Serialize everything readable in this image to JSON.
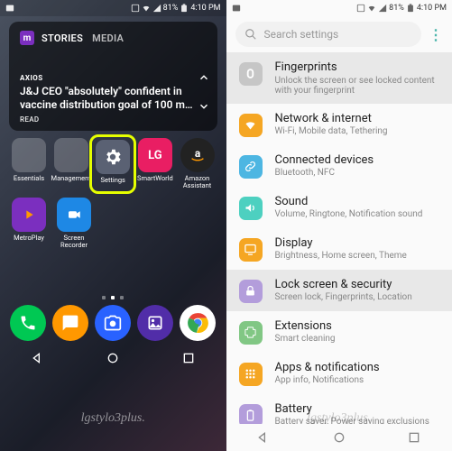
{
  "status": {
    "battery": "81%",
    "time": "4:10 PM"
  },
  "widget": {
    "tabs": [
      "STORIES",
      "MEDIA"
    ],
    "source": "AXIOS",
    "headline": "J&J CEO \"absolutely\" confident in vaccine distribution goal of 100 m…",
    "read": "READ"
  },
  "apps_row1": [
    {
      "label": "Essentials",
      "type": "folder"
    },
    {
      "label": "Management",
      "type": "folder-mgmt"
    },
    {
      "label": "Settings",
      "type": "settings",
      "highlight": true
    },
    {
      "label": "SmartWorld",
      "type": "lg"
    },
    {
      "label": "Amazon Assistant",
      "type": "amazon"
    }
  ],
  "apps_row2": [
    {
      "label": "MetroPlay",
      "type": "metro"
    },
    {
      "label": "Screen Recorder",
      "type": "recorder"
    }
  ],
  "search": {
    "placeholder": "Search settings"
  },
  "settings": [
    {
      "title": "Fingerprints",
      "sub": "Unlock the screen or see locked content with your fingerprint",
      "color": "#c6c6c6",
      "selected": true,
      "icon": "finger"
    },
    {
      "title": "Network & internet",
      "sub": "Wi-Fi, Mobile data, Tethering",
      "color": "#f5a623",
      "icon": "wifi"
    },
    {
      "title": "Connected devices",
      "sub": "Bluetooth, NFC",
      "color": "#4db6e2",
      "icon": "link"
    },
    {
      "title": "Sound",
      "sub": "Volume, Ringtone, Notification sound",
      "color": "#4dd0c0",
      "icon": "sound"
    },
    {
      "title": "Display",
      "sub": "Brightness, Home screen, Theme",
      "color": "#f5a623",
      "icon": "display"
    },
    {
      "title": "Lock screen & security",
      "sub": "Screen lock, Fingerprints, Location",
      "color": "#b39ddb",
      "selected": true,
      "icon": "lock"
    },
    {
      "title": "Extensions",
      "sub": "Smart cleaning",
      "color": "#81c784",
      "icon": "ext"
    },
    {
      "title": "Apps & notifications",
      "sub": "App info, Notifications",
      "color": "#f5a623",
      "icon": "apps"
    },
    {
      "title": "Battery",
      "sub": "Battery saver, Power saving exclusions",
      "color": "#b39ddb",
      "icon": "batt"
    }
  ],
  "watermark": "lgstylo3plus."
}
